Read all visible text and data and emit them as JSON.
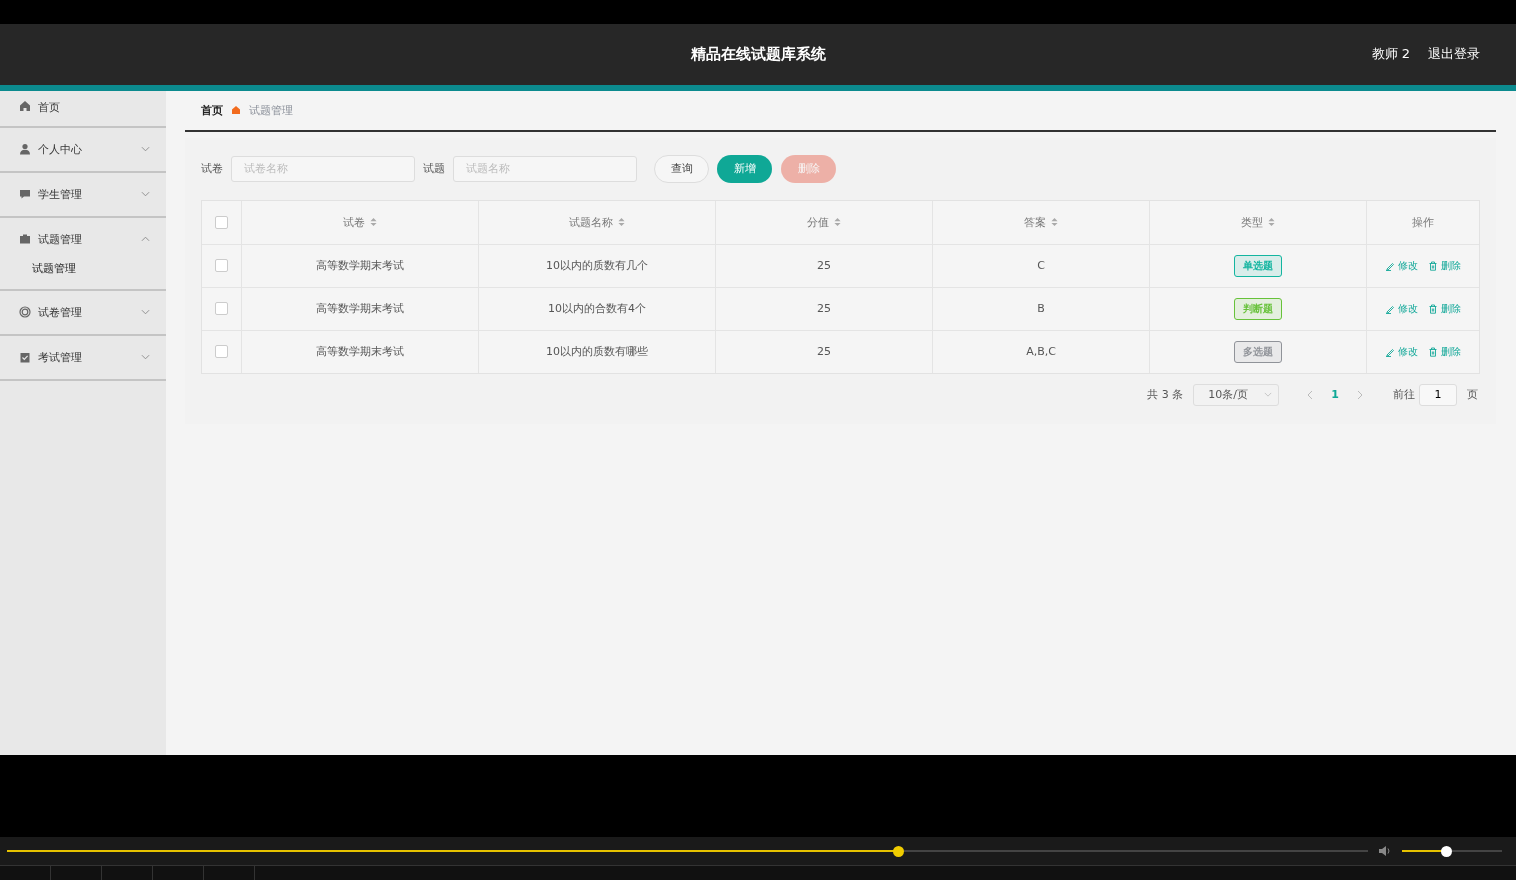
{
  "header": {
    "title": "精品在线试题库系统",
    "user": "教师 2",
    "logout": "退出登录"
  },
  "sidebar": {
    "items": [
      {
        "label": "首页",
        "kind": "link"
      },
      {
        "label": "个人中心",
        "kind": "menu",
        "expanded": false
      },
      {
        "label": "学生管理",
        "kind": "menu",
        "expanded": false
      },
      {
        "label": "试题管理",
        "kind": "menu",
        "expanded": true,
        "children": [
          {
            "label": "试题管理"
          }
        ]
      },
      {
        "label": "试卷管理",
        "kind": "menu",
        "expanded": false
      },
      {
        "label": "考试管理",
        "kind": "menu",
        "expanded": false
      }
    ]
  },
  "breadcrumb": [
    "首页",
    "试题管理"
  ],
  "search": {
    "fields": [
      {
        "label": "试卷",
        "placeholder": "试卷名称"
      },
      {
        "label": "试题",
        "placeholder": "试题名称"
      }
    ],
    "buttons": [
      {
        "label": "查询",
        "kind": "plain",
        "disabled": false
      },
      {
        "label": "新增",
        "kind": "primary",
        "disabled": false
      },
      {
        "label": "删除",
        "kind": "danger",
        "disabled": true
      }
    ]
  },
  "table": {
    "columns": [
      {
        "label": "试卷",
        "sortable": true
      },
      {
        "label": "试题名称",
        "sortable": true
      },
      {
        "label": "分值",
        "sortable": true
      },
      {
        "label": "答案",
        "sortable": true
      },
      {
        "label": "类型",
        "sortable": true
      },
      {
        "label": "操作",
        "sortable": false
      }
    ],
    "all_checked": false,
    "rows": [
      {
        "checked": false,
        "paper": "高等数学期末考试",
        "question": "10以内的质数有几个",
        "score": "25",
        "answer": "C",
        "type": {
          "label": "单选题",
          "color": "#13b5a0"
        },
        "actions": [
          "修改",
          "删除"
        ]
      },
      {
        "checked": false,
        "paper": "高等数学期末考试",
        "question": "10以内的合数有4个",
        "score": "25",
        "answer": "B",
        "type": {
          "label": "判断题",
          "color": "#67c23a"
        },
        "actions": [
          "修改",
          "删除"
        ]
      },
      {
        "checked": false,
        "paper": "高等数学期末考试",
        "question": "10以内的质数有哪些",
        "score": "25",
        "answer": "A,B,C",
        "type": {
          "label": "多选题",
          "color": "#909399"
        },
        "actions": [
          "修改",
          "删除"
        ]
      }
    ]
  },
  "pagination": {
    "total": "共 3 条",
    "page_size": "10条/页",
    "pages": [
      {
        "label": "1",
        "selected": true
      }
    ],
    "goto_label": "前往",
    "goto_value": "1",
    "goto_suffix": "页"
  },
  "player": {
    "progress": {
      "level": 0.655
    },
    "volume": {
      "level": 0.44
    }
  }
}
